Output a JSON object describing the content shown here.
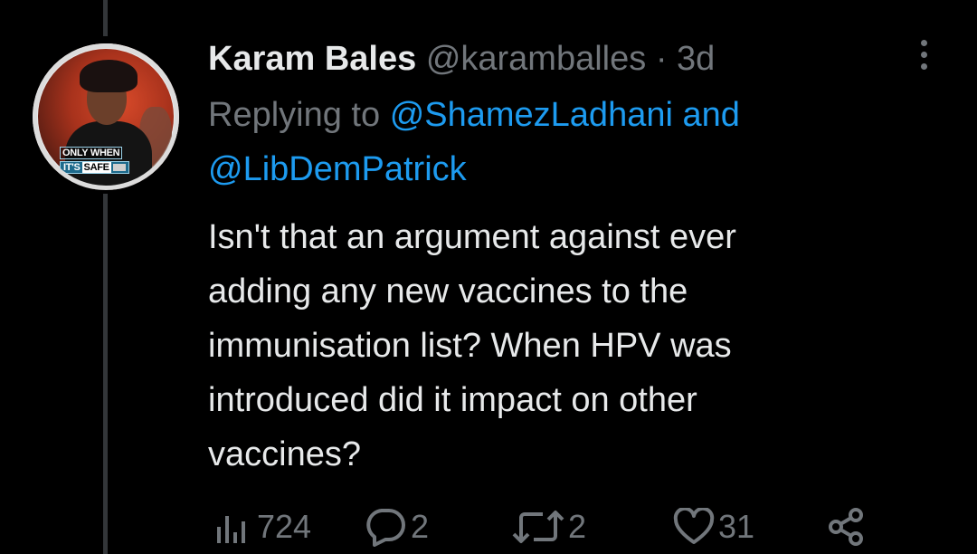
{
  "tweet": {
    "display_name": "Karam Bales",
    "handle": "@karamballes",
    "separator": "·",
    "time": "3d",
    "replying_label": "Replying to",
    "mention_1": "@ShamezLadhani",
    "conjunction": "and",
    "mention_2": "@LibDemPatrick",
    "text_lines": [
      "Isn't that an argument against ever",
      "adding any new vaccines to the",
      "immunisation list? When HPV was",
      "introduced did it impact on other",
      "vaccines?"
    ]
  },
  "avatar": {
    "banner_line1": "ONLY WHEN",
    "banner_line2": "IT'S",
    "banner_line2_badge": "SAFE"
  },
  "actions": {
    "views": "724",
    "replies": "2",
    "retweets": "2",
    "likes": "31"
  },
  "icons": {
    "views": "bar-chart-icon",
    "reply": "speech-bubble-icon",
    "retweet": "retweet-icon",
    "like": "heart-icon",
    "share": "share-icon",
    "more": "more-vertical-icon"
  },
  "colors": {
    "background": "#000000",
    "text": "#e7e9ea",
    "muted": "#71767b",
    "link": "#1d9bf0",
    "thread_line": "#333639"
  }
}
